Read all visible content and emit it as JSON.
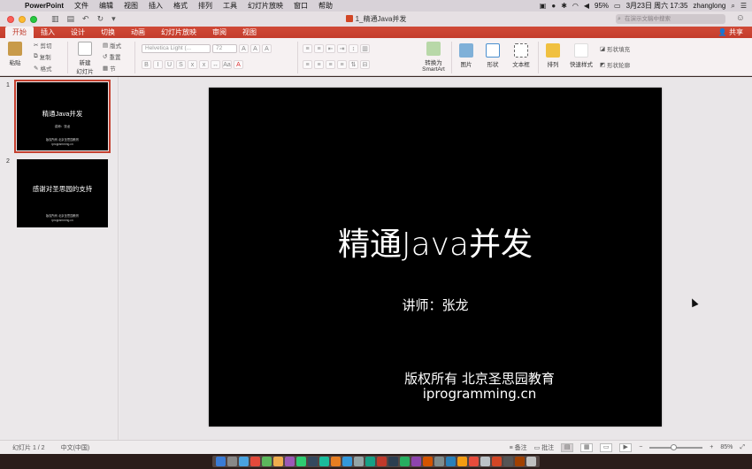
{
  "menubar": {
    "app_name": "PowerPoint",
    "items": [
      "文件",
      "编辑",
      "视图",
      "插入",
      "格式",
      "排列",
      "工具",
      "幻灯片放映",
      "窗口",
      "帮助"
    ],
    "battery": "95%",
    "datetime": "3月23日 周六 17:35",
    "user": "zhanglong"
  },
  "titlebar": {
    "doc_title": "1_精通Java并发",
    "search_placeholder": "在演示文稿中搜索"
  },
  "ribbon_tabs": {
    "items": [
      "开始",
      "插入",
      "设计",
      "切换",
      "动画",
      "幻灯片放映",
      "审阅",
      "视图"
    ],
    "active": "开始",
    "share": "共享"
  },
  "ribbon": {
    "paste": "粘贴",
    "cut": "剪切",
    "copy": "复制",
    "format": "格式",
    "new_slide_line1": "新建",
    "new_slide_line2": "幻灯片",
    "layout": "版式",
    "reset": "重置",
    "section": "节",
    "font_name": "Helvetica Light (...",
    "font_size": "72",
    "convert_line1": "转换为",
    "convert_line2": "SmartArt",
    "picture": "图片",
    "shape": "形状",
    "textbox": "文本框",
    "arrange": "排列",
    "quick_styles": "快速样式",
    "shape_fill": "形状填充",
    "shape_outline": "形状轮廓"
  },
  "thumbnails": [
    {
      "number": "1",
      "title": "精通Java并发",
      "subtitle": "讲师：张龙",
      "footer1": "版权所有 北京圣思园教育",
      "footer2": "iprogramming.cn"
    },
    {
      "number": "2",
      "title": "感谢对圣思园的支持",
      "footer1": "版权所有 北京圣思园教育",
      "footer2": "iprogramming.cn"
    }
  ],
  "slide": {
    "title": "精通Java并发",
    "subtitle": "讲师：张龙",
    "footer_line1": "版权所有  北京圣思园教育",
    "footer_line2": "iprogramming.cn"
  },
  "statusbar": {
    "slide_counter": "幻灯片 1 / 2",
    "language": "中文(中国)",
    "notes": "备注",
    "comments": "批注",
    "zoom": "85%"
  }
}
